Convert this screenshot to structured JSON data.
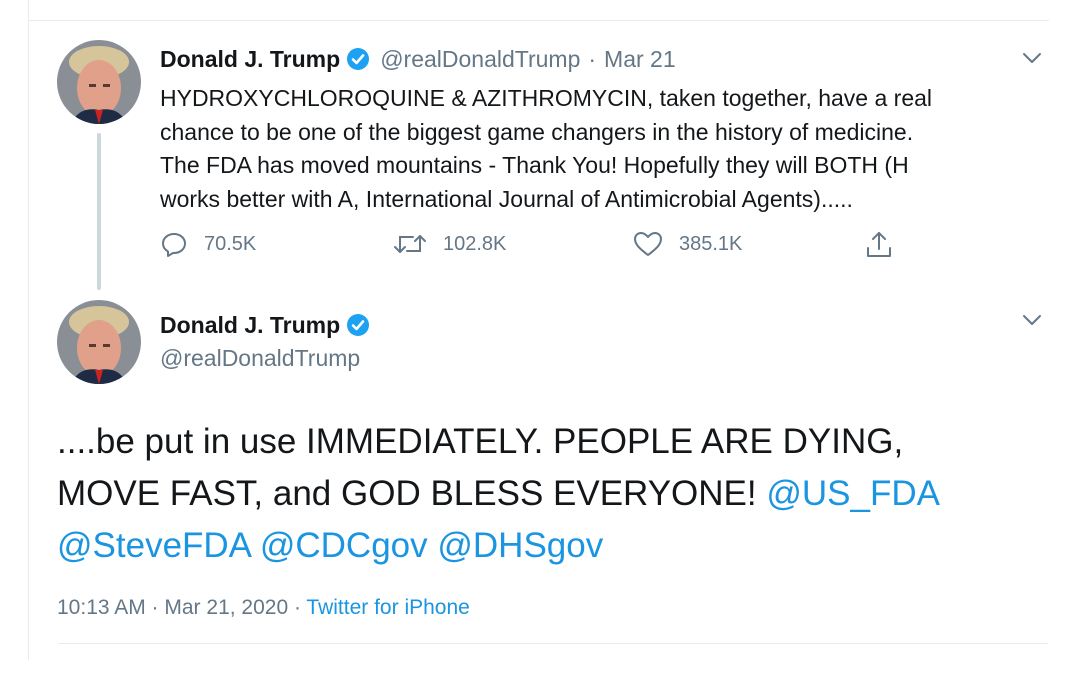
{
  "colors": {
    "link": "#1b95e0",
    "muted": "#657786",
    "verified": "#1da1f2",
    "thread_line": "#ccd6dd"
  },
  "tweet1": {
    "avatar_icon": "profile-photo",
    "name": "Donald J. Trump",
    "handle": "@realDonaldTrump",
    "separator": "·",
    "date": "Mar 21",
    "text_lines": [
      "HYDROXYCHLOROQUINE & AZITHROMYCIN, taken together, have a real",
      "chance to be one of the biggest game changers in the history of medicine.",
      "The FDA has moved mountains - Thank You! Hopefully they will BOTH (H",
      "works better with A, International Journal of Antimicrobial Agents)....."
    ],
    "replies": "70.5K",
    "retweets": "102.8K",
    "likes": "385.1K"
  },
  "tweet2": {
    "avatar_icon": "profile-photo",
    "name": "Donald J. Trump",
    "handle": "@realDonaldTrump",
    "line1": "....be put in use IMMEDIATELY. PEOPLE ARE DYING,",
    "line2_text": "MOVE FAST, and GOD BLESS EVERYONE! ",
    "mentions": [
      "@US_FDA",
      "@SteveFDA",
      "@CDCgov",
      "@DHSgov"
    ],
    "timestamp": "10:13 AM · Mar 21, 2020 · ",
    "source": "Twitter for iPhone"
  }
}
